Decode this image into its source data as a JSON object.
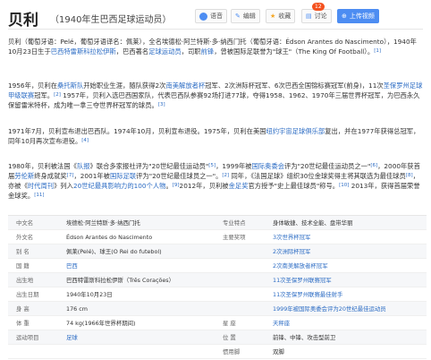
{
  "header": {
    "title": "贝利",
    "subtitle": "（1940年生巴西足球运动员）",
    "buttons": {
      "voice": "语音",
      "edit": "编辑",
      "favorite": "收藏",
      "discuss": "讨论",
      "discuss_count": "12",
      "upload": "上传视频"
    }
  },
  "paragraphs": [
    {
      "segments": [
        {
          "text": "贝利（葡萄牙语：Pelé，葡萄牙语译名：佩莱），全名埃德松·阿兰特斯·多·纳西门托（葡萄牙语：Édson Arantes do Nascimento），1940年10月23日生于"
        },
        {
          "text": "巴西特雷斯科拉松伊斯",
          "link": true
        },
        {
          "text": "，巴西著名"
        },
        {
          "text": "足球运动员",
          "link": true
        },
        {
          "text": "，司职"
        },
        {
          "text": "前锋",
          "link": true
        },
        {
          "text": "，曾被国际足联誉为\"球王\"（The King Of Football）。"
        },
        {
          "text": "[1]",
          "sup": true
        }
      ]
    },
    {
      "segments": [
        {
          "text": "1956年，贝利在"
        },
        {
          "text": "桑托斯队",
          "link": true
        },
        {
          "text": "开始职业生涯，随队获得2次"
        },
        {
          "text": "南美解放者杯",
          "link": true
        },
        {
          "text": "冠军、2次洲际杯冠军、6次巴西全国锦标赛冠军(前身)，11次"
        },
        {
          "text": "圣保罗州足球甲级联赛",
          "link": true
        },
        {
          "text": "冠军。"
        },
        {
          "text": "[2]",
          "sup": true
        },
        {
          "text": " 1957年，贝利入选巴西国家队，代表巴西队参赛92场打进77球，夺得1958、1962、1970年三届世界杯冠军，为巴西永久保留雷米特杯，成为唯一拿三夺世界杯冠军的球员。"
        },
        {
          "text": "[3]",
          "sup": true
        }
      ]
    },
    {
      "segments": [
        {
          "text": "1971年7月，贝利宣布退出巴西队。1974年10月，贝利宣布退役。1975年，贝利在美国"
        },
        {
          "text": "纽约宇宙足球俱乐部",
          "link": true
        },
        {
          "text": "复出，并在1977年获得总冠军，同年10月再次宣布退役。"
        },
        {
          "text": "[4]",
          "sup": true
        }
      ]
    },
    {
      "segments": [
        {
          "text": "1980年，贝利被法国《"
        },
        {
          "text": "队报",
          "link": true
        },
        {
          "text": "》联合多家报社评为\"20世纪最佳运动员\""
        },
        {
          "text": "[5]",
          "sup": true
        },
        {
          "text": "，1999年被"
        },
        {
          "text": "国际奥委会",
          "link": true
        },
        {
          "text": "评为\"20世纪最佳运动员之一\""
        },
        {
          "text": "[6]",
          "sup": true
        },
        {
          "text": "，2000年获首届"
        },
        {
          "text": "劳伦斯",
          "link": true
        },
        {
          "text": "终身成就奖"
        },
        {
          "text": "[7]",
          "sup": true
        },
        {
          "text": "，2001年被"
        },
        {
          "text": "国际足联",
          "link": true
        },
        {
          "text": "评为\"20世纪最佳球员之一\"。"
        },
        {
          "text": "[2]",
          "sup": true
        },
        {
          "text": " 同年，《法国足球》组织30位金球奖得主将其联选为最佳球员"
        },
        {
          "text": "[8]",
          "sup": true
        },
        {
          "text": "，亦被《"
        },
        {
          "text": "时代周刊",
          "link": true
        },
        {
          "text": "》列入"
        },
        {
          "text": "20世纪最具影响力的100个人物",
          "link": true
        },
        {
          "text": "。"
        },
        {
          "text": "[9]",
          "sup": true
        },
        {
          "text": "2012年，贝利被"
        },
        {
          "text": "金足奖",
          "link": true
        },
        {
          "text": "官方授予\"史上最佳球员\"称号。"
        },
        {
          "text": "[10]",
          "sup": true
        },
        {
          "text": " 2013年，获得首届荣誉金球奖。"
        },
        {
          "text": "[11]",
          "sup": true
        }
      ]
    }
  ],
  "infobox": [
    {
      "k1": "中文名",
      "v1": "埃德松·阿兰特斯·多·纳西门托",
      "k2": "专业特点",
      "v2": "身体敏捷、技术全能、盘带华丽"
    },
    {
      "k1": "外文名",
      "v1": "Édson Arantes do Nascimento",
      "k2": "主要奖项",
      "v2": "3次世界杯冠军"
    },
    {
      "k1": "别    名",
      "v1": "佩莱(Pelé)、球王(O Rei do futebol)",
      "k2": "",
      "v2": "2次洲际杯冠军"
    },
    {
      "k1": "国    籍",
      "v1": "巴西",
      "k2": "",
      "v2": "2次南美解放者杯冠军"
    },
    {
      "k1": "出生地",
      "v1": "巴西特雷斯科拉松伊斯（Três Corações）",
      "k2": "",
      "v2": "11次圣保罗州联赛冠军"
    },
    {
      "k1": "出生日期",
      "v1": "1940年10月23日",
      "k2": "",
      "v2": "11次圣保罗州联赛最佳射手"
    },
    {
      "k1": "身    高",
      "v1": "176 cm",
      "k2": "",
      "v2": "1999年被国际奥委会评为20世纪最佳运动员"
    },
    {
      "k1": "体    重",
      "v1": "74 kg(1966年世界杯期间)",
      "k2": "星    座",
      "v2": "天秤座"
    },
    {
      "k1": "运动项目",
      "v1": "足球",
      "k2": "位    置",
      "v2": "前锋、中锋、攻击型前卫"
    },
    {
      "k1": "",
      "v1": "",
      "k2": "惯用脚",
      "v2": "双脚"
    }
  ],
  "colors": {
    "link": "#2c6cc4",
    "primary_button": "#4d8df2",
    "badge": "#f4511e"
  }
}
